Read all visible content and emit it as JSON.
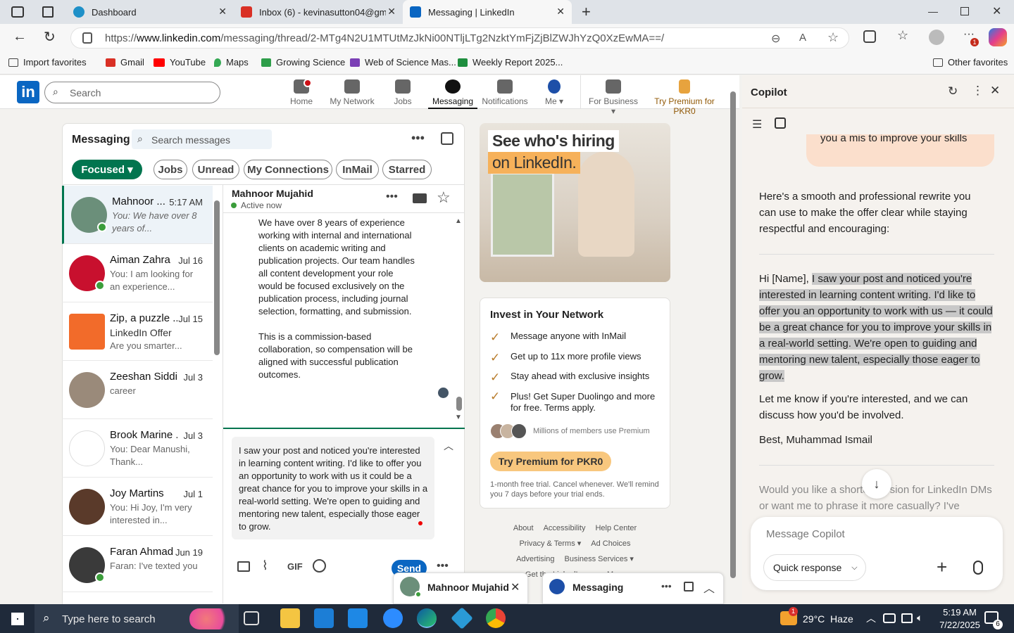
{
  "browser": {
    "tabs": [
      {
        "title": "Dashboard",
        "active": false
      },
      {
        "title": "Inbox (6) - kevinasutton04@gmai",
        "active": false
      },
      {
        "title": "Messaging | LinkedIn",
        "active": true
      }
    ],
    "url_prefix": "https://",
    "url_domain": "www.linkedin.com",
    "url_path": "/messaging/thread/2-MTg4N2U1MTUtMzJkNi00NTljLTg2NzktYmFjZjBlZWJhYzQ0XzEwMA==/",
    "bookmarks": [
      "Import favorites",
      "Gmail",
      "YouTube",
      "Maps",
      "Growing Science",
      "Web of Science Mas...",
      "Weekly Report 2025..."
    ],
    "other_favorites": "Other favorites",
    "notif_count": "1"
  },
  "linkedin": {
    "logo": "in",
    "search_placeholder": "Search",
    "nav": [
      {
        "label": "Home"
      },
      {
        "label": "My Network"
      },
      {
        "label": "Jobs"
      },
      {
        "label": "Messaging"
      },
      {
        "label": "Notifications"
      },
      {
        "label": "Me ▾"
      },
      {
        "label": "For Business ▾"
      },
      {
        "label": "Try Premium for PKR0"
      }
    ]
  },
  "messaging": {
    "title": "Messaging",
    "search_placeholder": "Search messages",
    "filters": [
      "Focused ▾",
      "Jobs",
      "Unread",
      "My Connections",
      "InMail",
      "Starred"
    ],
    "conversations": [
      {
        "name": "Mahnoor ...",
        "date": "5:17 AM",
        "preview": "You: We have over 8 years of...",
        "color": "#6b8f7a"
      },
      {
        "name": "Aiman Zahra",
        "date": "Jul 16",
        "preview": "You: I am looking for an experience...",
        "color": "#c8102e"
      },
      {
        "name": "Zip, a puzzle ...",
        "date": "Jul 15",
        "preview": "LinkedIn Offer",
        "preview2": "Are you smarter...",
        "color": "#f26b2a"
      },
      {
        "name": "Zeeshan Siddi...",
        "date": "Jul 3",
        "preview": "career",
        "color": "#9a8a7a"
      },
      {
        "name": "Brook Marine ...",
        "date": "Jul 3",
        "preview": "You: Dear Manushi, Thank...",
        "color": "#ffffff"
      },
      {
        "name": "Joy Martins",
        "date": "Jul 1",
        "preview": "You: Hi Joy, I'm very interested in...",
        "color": "#5a3a2a"
      },
      {
        "name": "Faran Ahmad",
        "date": "Jun 19",
        "preview": "Faran: I've texted you",
        "color": "#3a3a3a"
      }
    ],
    "thread": {
      "name": "Mahnoor Mujahid",
      "status": "Active now",
      "message_p1": "We have over 8 years of experience working with internal and international clients on academic writing and publication projects. Our team handles all content development your role would be focused exclusively on the publication process, including journal selection, formatting, and submission.",
      "message_p2": "This is a commission-based collaboration, so compensation will be aligned with successful publication outcomes.",
      "draft": "I saw your post and noticed you're interested in learning content writing. I'd like to offer you an opportunity to work with us  it could be a great chance for you to improve your skills in a real-world setting. We're open to guiding and mentoring new talent, especially those eager to grow.",
      "send": "Send",
      "gif": "GIF"
    }
  },
  "ad": {
    "headline1": "See who's hiring",
    "headline2": "on LinkedIn."
  },
  "premium": {
    "title": "Invest in Your Network",
    "items": [
      "Message anyone with InMail",
      "Get up to 11x more profile views",
      "Stay ahead with exclusive insights",
      "Plus! Get Super Duolingo and more for free. Terms apply."
    ],
    "members": "Millions of members use Premium",
    "button": "Try Premium for PKR0",
    "fineprint": "1-month free trial. Cancel whenever. We'll remind you 7 days before your trial ends."
  },
  "footer": {
    "row1": [
      "About",
      "Accessibility",
      "Help Center"
    ],
    "row2": [
      "Privacy & Terms ▾",
      "Ad Choices"
    ],
    "row3": [
      "Advertising",
      "Business Services ▾"
    ],
    "row4": [
      "Get the LinkedIn app",
      "More"
    ]
  },
  "chatbar": {
    "popup_name": "Mahnoor Mujahid",
    "messaging_label": "Messaging"
  },
  "copilot": {
    "title": "Copilot",
    "user_bubble_tail": "you a mis to improve your skills",
    "intro": "Here's a smooth and professional rewrite you can use to make the offer clear while staying respectful and encouraging:",
    "greeting": "Hi [Name], ",
    "highlighted": "I saw your post and noticed you're interested in learning content writing. I'd like to offer you an opportunity to work with us — it could be a great chance for you to improve your skills in a real-world setting. We're open to guiding and mentoring new talent, especially those eager to grow.",
    "followup": "Let me know if you're interested, and we can discuss how you'd be involved.",
    "signoff": "Best, Muhammad Ismail",
    "question": "Would you like a shorter version for LinkedIn DMs or want me to phrase it more casually? I've",
    "input_placeholder": "Message Copilot",
    "quick_response": "Quick response"
  },
  "taskbar": {
    "search_placeholder": "Type here to search",
    "weather": "29°C  Haze",
    "weather_badge": "1",
    "time": "5:19 AM",
    "date": "7/22/2025",
    "notif_count": "6"
  }
}
